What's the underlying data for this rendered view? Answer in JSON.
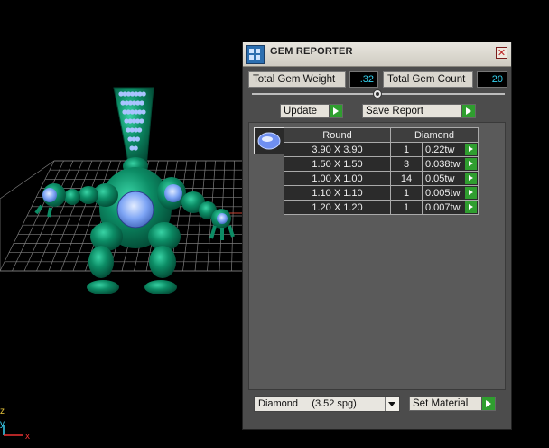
{
  "panel": {
    "title": "GEM REPORTER",
    "close_glyph": "✕",
    "total_weight_label": "Total Gem Weight",
    "total_weight_value": ".32",
    "total_count_label": "Total Gem Count",
    "total_count_value": "20",
    "update_label": "Update",
    "save_report_label": "Save Report",
    "table": {
      "header_shape": "Round",
      "header_material": "Diamond",
      "rows": [
        {
          "size": "3.90 X 3.90",
          "qty": "1",
          "weight": "0.22tw"
        },
        {
          "size": "1.50 X 1.50",
          "qty": "3",
          "weight": "0.038tw"
        },
        {
          "size": "1.00 X 1.00",
          "qty": "14",
          "weight": "0.05tw"
        },
        {
          "size": "1.10 X 1.10",
          "qty": "1",
          "weight": "0.005tw"
        },
        {
          "size": "1.20 X 1.20",
          "qty": "1",
          "weight": "0.007tw"
        }
      ]
    },
    "material_select": "Diamond     (3.52 spg)",
    "set_material_label": "Set Material"
  },
  "viewport": {
    "axis_z": "z",
    "axis_y": "y",
    "axis_x": "x"
  },
  "colors": {
    "model": "#0d8a66",
    "gem": "#8fb6ff",
    "accent": "#2f9e2f",
    "value_text": "#35d3f0"
  },
  "icons": [
    "app-icon",
    "close-icon",
    "play-arrow-icon",
    "dropdown-arrow-icon",
    "gem-swatch-icon"
  ]
}
